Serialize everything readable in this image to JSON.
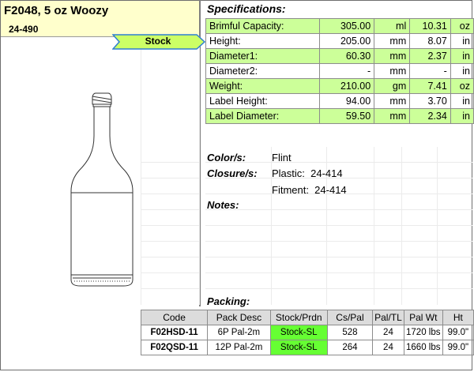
{
  "header": {
    "title": "F2048, 5 oz Woozy",
    "neck_finish": "24-490",
    "stock_flag": "Stock"
  },
  "specifications": {
    "heading": "Specifications:",
    "rows": [
      {
        "label": "Brimful Capacity:",
        "metric_value": "305.00",
        "metric_unit": "ml",
        "imperial_value": "10.31",
        "imperial_unit": "oz",
        "highlight": true
      },
      {
        "label": "Height:",
        "metric_value": "205.00",
        "metric_unit": "mm",
        "imperial_value": "8.07",
        "imperial_unit": "in",
        "highlight": false
      },
      {
        "label": "Diameter1:",
        "metric_value": "60.30",
        "metric_unit": "mm",
        "imperial_value": "2.37",
        "imperial_unit": "in",
        "highlight": true
      },
      {
        "label": "Diameter2:",
        "metric_value": "-",
        "metric_unit": "mm",
        "imperial_value": "-",
        "imperial_unit": "in",
        "highlight": false
      },
      {
        "label": "Weight:",
        "metric_value": "210.00",
        "metric_unit": "gm",
        "imperial_value": "7.41",
        "imperial_unit": "oz",
        "highlight": true
      },
      {
        "label": "Label Height:",
        "metric_value": "94.00",
        "metric_unit": "mm",
        "imperial_value": "3.70",
        "imperial_unit": "in",
        "highlight": false
      },
      {
        "label": "Label Diameter:",
        "metric_value": "59.50",
        "metric_unit": "mm",
        "imperial_value": "2.34",
        "imperial_unit": "in",
        "highlight": true
      }
    ]
  },
  "details": {
    "color_label": "Color/s:",
    "color_value": "Flint",
    "closure_label": "Closure/s:",
    "closure_line1": "Plastic:  24-414",
    "closure_line2": "Fitment:  24-414",
    "notes_label": "Notes:"
  },
  "packing": {
    "heading": "Packing:",
    "columns": [
      "Code",
      "Pack Desc",
      "Stock/Prdn",
      "Cs/Pal",
      "Pal/TL",
      "Pal Wt",
      "Ht"
    ],
    "rows": [
      {
        "code": "F02HSD-11",
        "pack_desc": "6P Pal-2m",
        "stock_prdn": "Stock-SL",
        "cs_pal": "528",
        "pal_tl": "24",
        "pal_wt": "1720 lbs",
        "ht": "99.0\""
      },
      {
        "code": "F02QSD-11",
        "pack_desc": "12P Pal-2m",
        "stock_prdn": "Stock-SL",
        "cs_pal": "264",
        "pal_tl": "24",
        "pal_wt": "1660 lbs",
        "ht": "99.0\""
      }
    ]
  },
  "colors": {
    "highlight_green": "#ccff99",
    "stock_green": "#66ff33",
    "title_yellow": "#ffffcc",
    "flag_fill": "#ccff66",
    "flag_border": "#2f7fd0"
  },
  "icons": {
    "stock_flag": "arrow-flag-shape",
    "product_image": "bottle-drawing"
  }
}
